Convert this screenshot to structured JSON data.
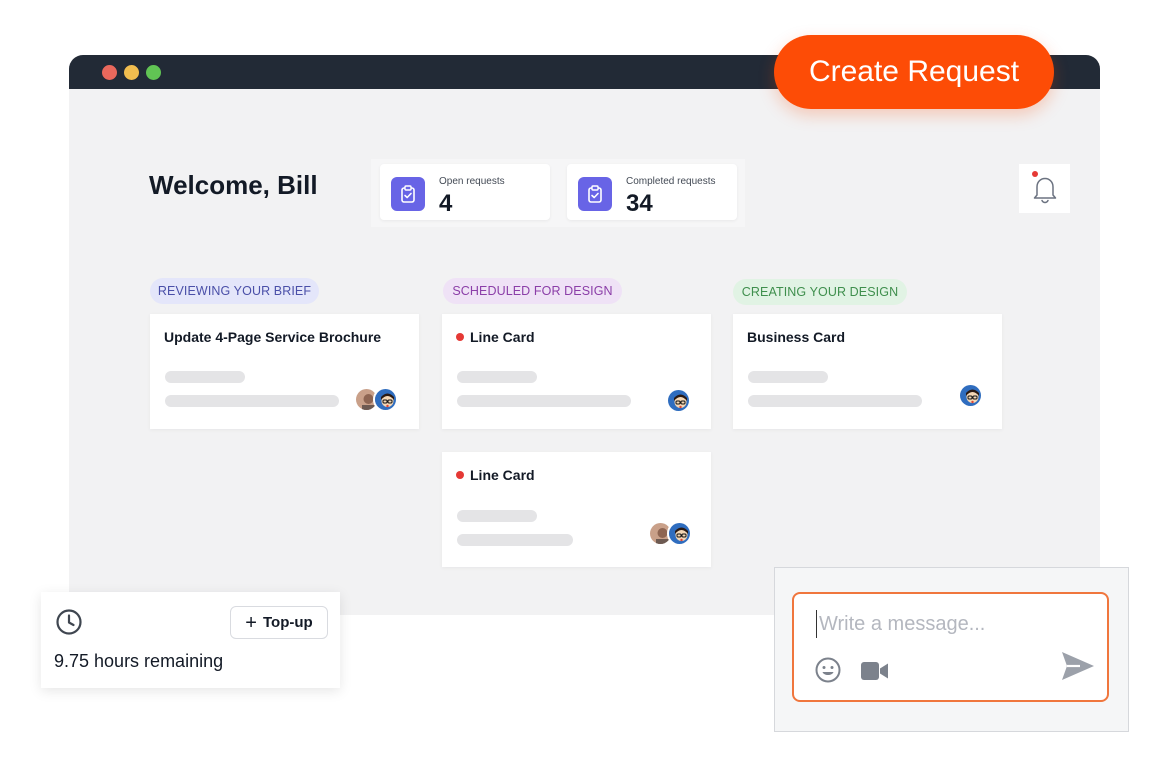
{
  "header": {
    "create_button_label": "Create Request"
  },
  "dashboard": {
    "welcome": "Welcome, Bill",
    "stats": [
      {
        "label": "Open requests",
        "value": "4"
      },
      {
        "label": "Completed requests",
        "value": "34"
      }
    ]
  },
  "columns": [
    {
      "status": "REVIEWING YOUR BRIEF",
      "status_color": "#4a4fa8",
      "cards": [
        {
          "title": "Update 4-Page Service Brochure",
          "urgent": false
        }
      ]
    },
    {
      "status": "SCHEDULED FOR DESIGN",
      "status_color": "#8b3ea8",
      "cards": [
        {
          "title": "Line Card",
          "urgent": true
        },
        {
          "title": "Line Card",
          "urgent": true
        }
      ]
    },
    {
      "status": "CREATING YOUR DESIGN",
      "status_color": "#3f8f4d",
      "cards": [
        {
          "title": "Business Card",
          "urgent": false
        }
      ]
    }
  ],
  "hours_panel": {
    "topup_label": "Top-up",
    "remaining": "9.75 hours remaining"
  },
  "composer": {
    "placeholder": "Write a message...",
    "icons": [
      "emoji-icon",
      "video-icon",
      "send-icon"
    ]
  },
  "colors": {
    "accent": "#fd4c06",
    "stat_icon": "#6864e6",
    "urgent_dot": "#e53935"
  }
}
